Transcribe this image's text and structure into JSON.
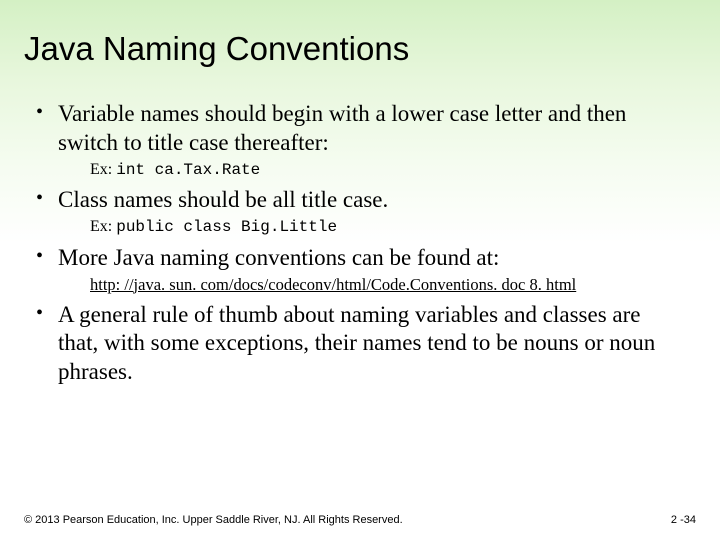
{
  "title": "Java Naming Conventions",
  "bullets": {
    "b1": "Variable names should begin with a lower case letter and then switch to title case thereafter:",
    "b1_ex_label": "Ex: ",
    "b1_ex_code": "int ca.Tax.Rate",
    "b2": "Class names should be all title case.",
    "b2_ex_label": "Ex: ",
    "b2_ex_code": "public class Big.Little",
    "b3": "More Java naming conventions can be found at:",
    "b3_link": "http: //java. sun. com/docs/codeconv/html/Code.Conventions. doc 8. html",
    "b4": "A general rule of thumb about naming variables and classes are that, with some exceptions, their names tend to be nouns or noun phrases."
  },
  "footer": {
    "copyright": "© 2013 Pearson Education, Inc. Upper Saddle River, NJ. All Rights Reserved.",
    "page": "2 -34"
  }
}
